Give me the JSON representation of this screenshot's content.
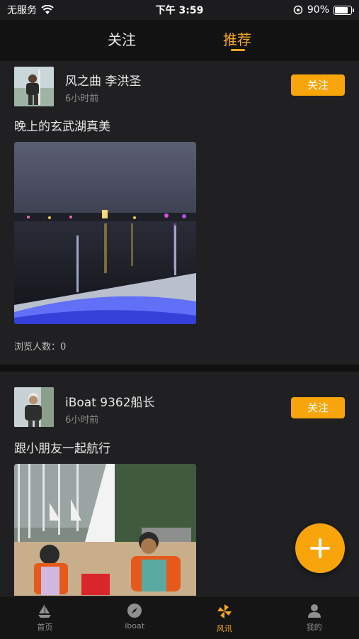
{
  "status_bar": {
    "carrier": "无服务",
    "time": "下午 3:59",
    "battery_percent": "90%",
    "battery_level": 0.9
  },
  "top_tabs": {
    "follow": "关注",
    "recommend": "推荐",
    "active": "recommend"
  },
  "posts": [
    {
      "username": "风之曲 李洪圣",
      "time": "6小时前",
      "follow_label": "关注",
      "text": "晚上的玄武湖真美",
      "views": "浏览人数：0"
    },
    {
      "username": "iBoat 9362船长",
      "time": "6小时前",
      "follow_label": "关注",
      "text": "跟小朋友一起航行"
    }
  ],
  "bottom_nav": [
    {
      "label": "首页",
      "icon": "sailboat-icon"
    },
    {
      "label": "iboat",
      "icon": "compass-icon"
    },
    {
      "label": "风讯",
      "icon": "pinwheel-icon",
      "active": true
    },
    {
      "label": "我的",
      "icon": "user-icon"
    }
  ],
  "colors": {
    "accent": "#f7a50b",
    "background": "#1c1c1e"
  }
}
